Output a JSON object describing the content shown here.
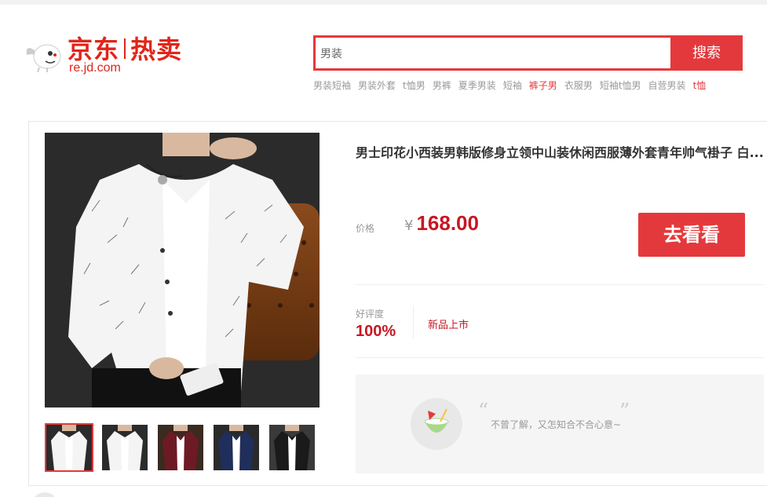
{
  "header": {
    "logo": {
      "brand": "京东",
      "channel": "热卖",
      "domain": "re.jd.com"
    },
    "search": {
      "value": "男装",
      "button_label": "搜索"
    },
    "hotwords": [
      {
        "label": "男装短袖",
        "highlight": false
      },
      {
        "label": "男装外套",
        "highlight": false
      },
      {
        "label": "t恤男",
        "highlight": false
      },
      {
        "label": "男裤",
        "highlight": false
      },
      {
        "label": "夏季男装",
        "highlight": false
      },
      {
        "label": "短袖",
        "highlight": false
      },
      {
        "label": "裤子男",
        "highlight": true
      },
      {
        "label": "衣服男",
        "highlight": false
      },
      {
        "label": "短袖t恤男",
        "highlight": false
      },
      {
        "label": "自营男装",
        "highlight": false
      },
      {
        "label": "t恤",
        "highlight": true
      }
    ]
  },
  "product": {
    "title": "男士印花小西装男韩版修身立领中山装休闲西服薄外套青年帅气褂子 白...",
    "price_label": "价格",
    "currency": "¥",
    "price": "168.00",
    "cta_label": "去看看",
    "rating_label": "好评度",
    "rating_value": "100%",
    "tag": "新品上市",
    "thumbnails": [
      {
        "color": "white",
        "active": true
      },
      {
        "color": "white",
        "active": false
      },
      {
        "color": "wine-red",
        "active": false
      },
      {
        "color": "navy",
        "active": false
      },
      {
        "color": "black",
        "active": false
      }
    ]
  },
  "review": {
    "open_quote": "“",
    "close_quote": "”",
    "text": "不曾了解，又怎知合不合心意~"
  },
  "colors": {
    "brand_red": "#e4393c",
    "price_red": "#c81623"
  }
}
